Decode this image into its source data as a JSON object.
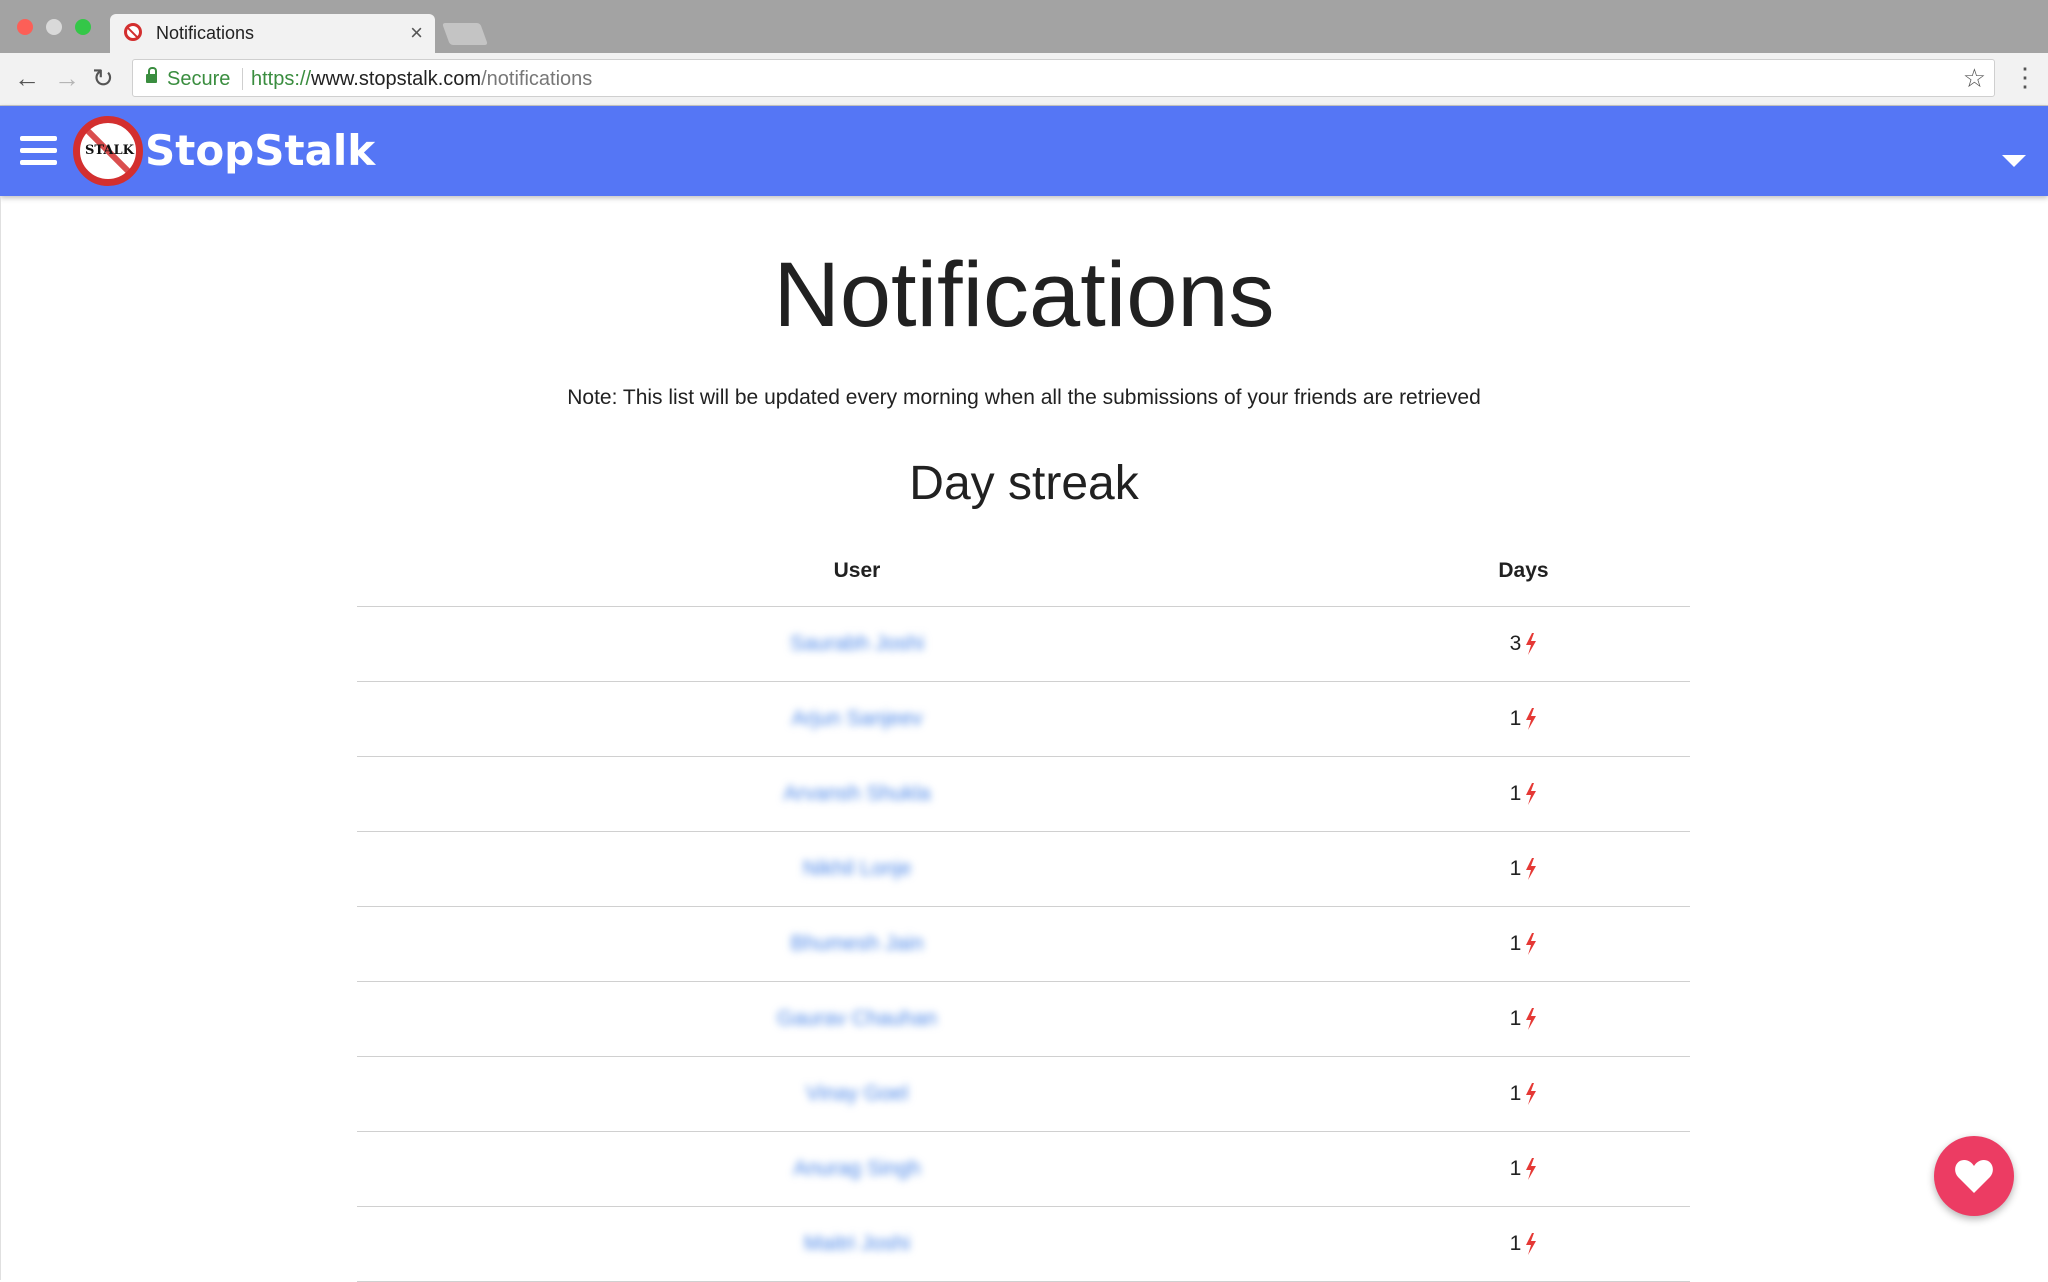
{
  "browser": {
    "tab_title": "Notifications",
    "tab_close": "×",
    "secure_label": "Secure",
    "url_scheme": "https://",
    "url_host": "www.stopstalk.com",
    "url_path": "/notifications",
    "back_icon": "←",
    "forward_icon": "→",
    "reload_icon": "↻",
    "star_icon": "☆",
    "menu_icon": "⋮"
  },
  "header": {
    "brand": "StopStalk",
    "logo_text": "STALK",
    "bar_color": "#5576f5"
  },
  "main": {
    "title": "Notifications",
    "note": "Note: This list will be updated every morning when all the submissions of your friends are retrieved",
    "section_title": "Day streak",
    "columns": {
      "user": "User",
      "days": "Days"
    },
    "rows": [
      {
        "user": "Saurabh Joshi",
        "days": "3"
      },
      {
        "user": "Arjun Sanjeev",
        "days": "1"
      },
      {
        "user": "Arvansh Shukla",
        "days": "1"
      },
      {
        "user": "Nikhil Lonje",
        "days": "1"
      },
      {
        "user": "Bhumesh Jain",
        "days": "1"
      },
      {
        "user": "Gaurav Chauhan",
        "days": "1"
      },
      {
        "user": "Vinay Goel",
        "days": "1"
      },
      {
        "user": "Anurag Singh",
        "days": "1"
      },
      {
        "user": "Maitri Joshi",
        "days": "1"
      }
    ],
    "streak_icon": "bolt-icon",
    "streak_icon_color": "#e53935",
    "link_color": "#4a86e8"
  },
  "fab": {
    "icon": "heart-icon",
    "color": "#ec3c63"
  }
}
